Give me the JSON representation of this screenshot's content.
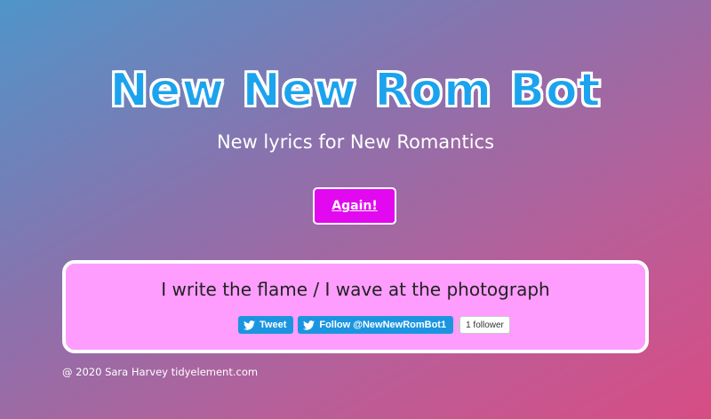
{
  "header": {
    "title": "New New Rom Bot",
    "subtitle": "New lyrics for New Romantics"
  },
  "actions": {
    "again_label": "Again!"
  },
  "lyric_card": {
    "lyric": "I write the flame / I wave at the photograph",
    "tweet_label": "Tweet",
    "follow_label": "Follow @NewNewRomBot1",
    "follower_count": "1 follower",
    "icon": "twitter-bird-icon"
  },
  "footer": {
    "credit": "@ 2020 Sara Harvey tidyelement.com"
  },
  "colors": {
    "title": "#1ca3ee",
    "button": "#e208f0",
    "card": "#fe9dfe",
    "twitter": "#1b95e0"
  }
}
